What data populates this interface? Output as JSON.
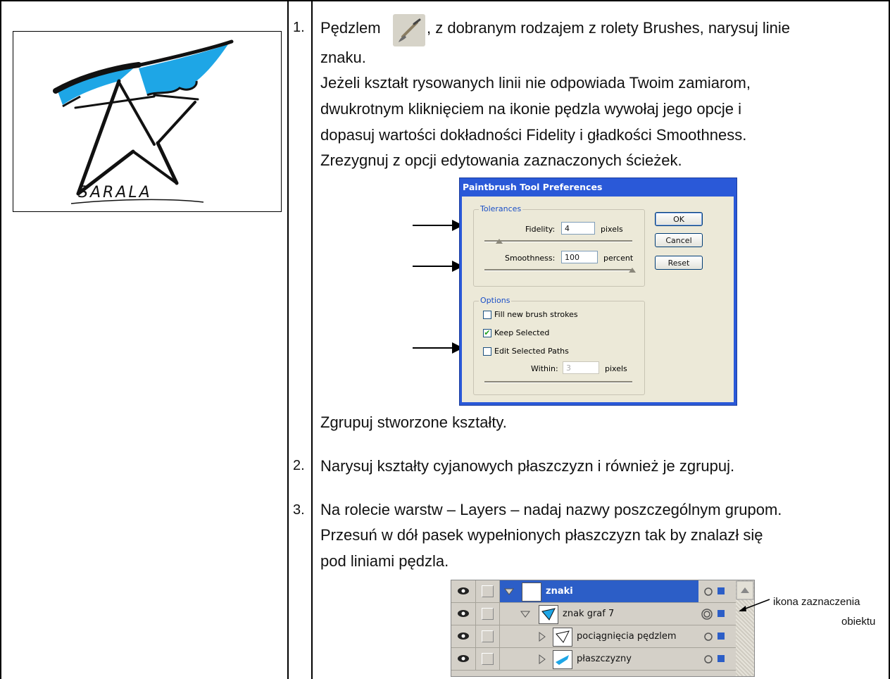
{
  "step1": {
    "number": "1.",
    "line1_before_icon": "Pędzlem",
    "line1_after_icon": ", z dobranym rodzajem z rolety Brushes, narysuj linie",
    "line2": "znaku.",
    "line3": "Jeżeli kształt rysowanych linii nie odpowiada Twoim zamiarom,",
    "line4": "dwukrotnym kliknięciem na ikonie pędzla wywołaj jego opcje i",
    "line5": "dopasuj wartości dokładności Fidelity i gładkości Smoothness.",
    "line6": "Zrezygnuj z opcji edytowania zaznaczonych ścieżek.",
    "after_dialog": "Zgrupuj stworzone kształty."
  },
  "logo": {
    "wordmark": "SARALA",
    "colors": {
      "accent": "#1ea6e6",
      "stroke": "#111111"
    }
  },
  "dialog": {
    "title": "Paintbrush Tool Preferences",
    "tolerances_legend": "Tolerances",
    "fidelity_label": "Fidelity:",
    "fidelity_value": "4",
    "fidelity_unit": "pixels",
    "fidelity_level": 0.1,
    "smoothness_label": "Smoothness:",
    "smoothness_value": "100",
    "smoothness_unit": "percent",
    "smoothness_level": 1.0,
    "options_legend": "Options",
    "fill_label": "Fill new brush strokes",
    "fill_checked": false,
    "keep_label": "Keep Selected",
    "keep_checked": true,
    "edit_label": "Edit Selected Paths",
    "edit_checked": false,
    "within_label": "Within:",
    "within_value": "3",
    "within_unit": "pixels",
    "ok_label": "OK",
    "cancel_label": "Cancel",
    "reset_label": "Reset"
  },
  "step2": {
    "number": "2.",
    "text": "Narysuj kształty cyjanowych płaszczyzn i również je zgrupuj."
  },
  "step3": {
    "number": "3.",
    "line1": "Na rolecie warstw – Layers – nadaj nazwy poszczególnym grupom.",
    "line2": "Przesuń w dół pasek wypełnionych płaszczyzn tak by znalazł się",
    "line3": "pod liniami pędzla."
  },
  "layers": {
    "rows": [
      {
        "name": "znaki",
        "selected": true
      },
      {
        "name": "znak graf 7",
        "selected": false
      },
      {
        "name": "pociągnięcia pędzlem",
        "selected": false
      },
      {
        "name": "płaszczyzny",
        "selected": false
      }
    ],
    "annotation_line1": "ikona zaznaczenia",
    "annotation_line2": "obiektu"
  }
}
